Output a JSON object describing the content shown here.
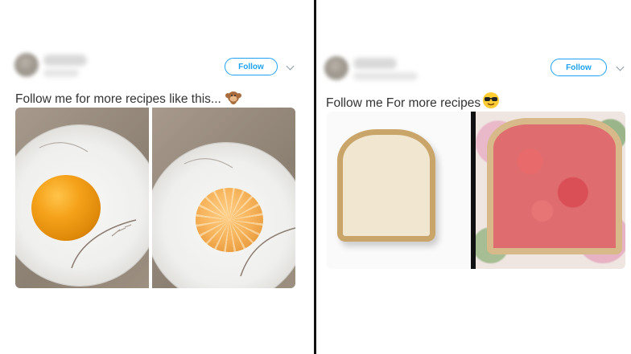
{
  "left_tweet": {
    "follow_label": "Follow",
    "text": "Follow me for more recipes like this...",
    "emoji_icon": "monkey-emoji"
  },
  "right_tweet": {
    "follow_label": "Follow",
    "text": "Follow me For more recipes",
    "emoji_icon": "sunglasses-face-emoji"
  },
  "colors": {
    "follow_blue": "#1da1f2",
    "divider": "#111111"
  }
}
